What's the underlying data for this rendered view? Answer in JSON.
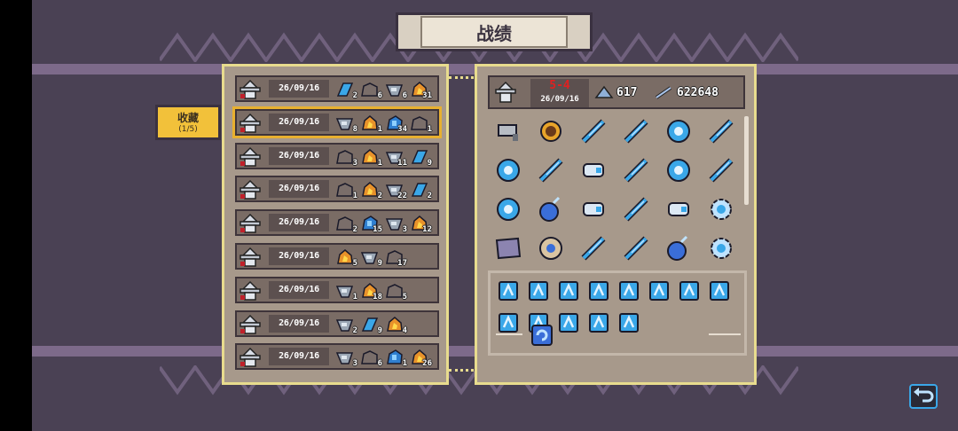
{
  "title": "战绩",
  "favorites_tab": {
    "label": "收藏",
    "count": "(1/5)"
  },
  "runs": [
    {
      "date": "26/09/16",
      "mats": [
        {
          "icon": "blue-crystal-icon",
          "count": "2"
        },
        {
          "icon": "stone-icon",
          "count": "6"
        },
        {
          "icon": "iron-ore-icon",
          "count": "6"
        },
        {
          "icon": "fire-ore-icon",
          "count": "31"
        }
      ]
    },
    {
      "date": "26/09/16",
      "mats": [
        {
          "icon": "iron-ore-icon",
          "count": "8"
        },
        {
          "icon": "fire-ore-icon",
          "count": "1"
        },
        {
          "icon": "blue-ore-icon",
          "count": "34"
        },
        {
          "icon": "stone-icon",
          "count": "1"
        }
      ]
    },
    {
      "date": "26/09/16",
      "mats": [
        {
          "icon": "stone-icon",
          "count": "3"
        },
        {
          "icon": "fire-ore-icon",
          "count": "1"
        },
        {
          "icon": "iron-ore-icon",
          "count": "11"
        },
        {
          "icon": "blue-crystal-icon",
          "count": "9"
        }
      ]
    },
    {
      "date": "26/09/16",
      "mats": [
        {
          "icon": "stone-icon",
          "count": "1"
        },
        {
          "icon": "fire-ore-icon",
          "count": "2"
        },
        {
          "icon": "iron-ore-icon",
          "count": "22"
        },
        {
          "icon": "blue-crystal-icon",
          "count": "2"
        }
      ]
    },
    {
      "date": "26/09/16",
      "mats": [
        {
          "icon": "stone-icon",
          "count": "2"
        },
        {
          "icon": "blue-ore-icon",
          "count": "15"
        },
        {
          "icon": "iron-ore-icon",
          "count": "3"
        },
        {
          "icon": "fire-ore-icon",
          "count": "12"
        }
      ]
    },
    {
      "date": "26/09/16",
      "mats": [
        {
          "icon": "fire-ore-icon",
          "count": "5"
        },
        {
          "icon": "iron-ore-icon",
          "count": "9"
        },
        {
          "icon": "stone-icon",
          "count": "17"
        }
      ]
    },
    {
      "date": "26/09/16",
      "mats": [
        {
          "icon": "iron-ore-icon",
          "count": "1"
        },
        {
          "icon": "fire-ore-icon",
          "count": "18"
        },
        {
          "icon": "stone-icon",
          "count": "5"
        }
      ]
    },
    {
      "date": "26/09/16",
      "mats": [
        {
          "icon": "iron-ore-icon",
          "count": "2"
        },
        {
          "icon": "blue-crystal-icon",
          "count": "9"
        },
        {
          "icon": "fire-ore-icon",
          "count": "4"
        }
      ]
    },
    {
      "date": "26/09/16",
      "mats": [
        {
          "icon": "iron-ore-icon",
          "count": "3"
        },
        {
          "icon": "stone-icon",
          "count": "6"
        },
        {
          "icon": "blue-ore-icon",
          "count": "1"
        },
        {
          "icon": "fire-ore-icon",
          "count": "26"
        }
      ]
    }
  ],
  "detail": {
    "rank": "5-4",
    "date": "26/09/16",
    "stat_a": "617",
    "stat_b": "622648",
    "weapons": [
      "gun-barrel-icon",
      "gold-shield-icon",
      "blue-feather-icon",
      "blue-crystal-blade-icon",
      "blue-orb-icon",
      "blue-sword-icon",
      "blue-shield-orb-icon",
      "blue-claws-icon",
      "blue-gauntlet-icon",
      "blue-boomerang-icon",
      "blue-orb-icon",
      "blue-staff-icon",
      "blue-shield-orb-icon",
      "blue-bomb-icon",
      "blue-gauntlet-icon",
      "blue-nunchaku-icon",
      "blue-gauntlet-icon",
      "blue-gear-icon",
      "map-scroll-icon",
      "target-shield-icon",
      "blue-sword-icon",
      "blue-staff-icon",
      "blue-bomb-icon",
      "blue-gear-icon"
    ],
    "buffs": [
      "lightning-buff-icon",
      "shield-square-buff-icon",
      "armor-buff-icon",
      "scatter-buff-icon",
      "heart-shield-buff-icon",
      "scroll-buff-icon",
      "double-heart-buff-icon",
      "fist-buff-icon",
      "crossed-arrows-buff-icon",
      "cross-shield-buff-icon",
      "ring-buff-icon",
      "arrow-right-buff-icon",
      "home-buff-icon"
    ],
    "extra": "blue-swirl-icon"
  },
  "colors": {
    "accent": "#f2c13a",
    "panel_border": "#e8dc8e",
    "rank_red": "#e02020",
    "icon_blue": "#3aa7e8"
  }
}
